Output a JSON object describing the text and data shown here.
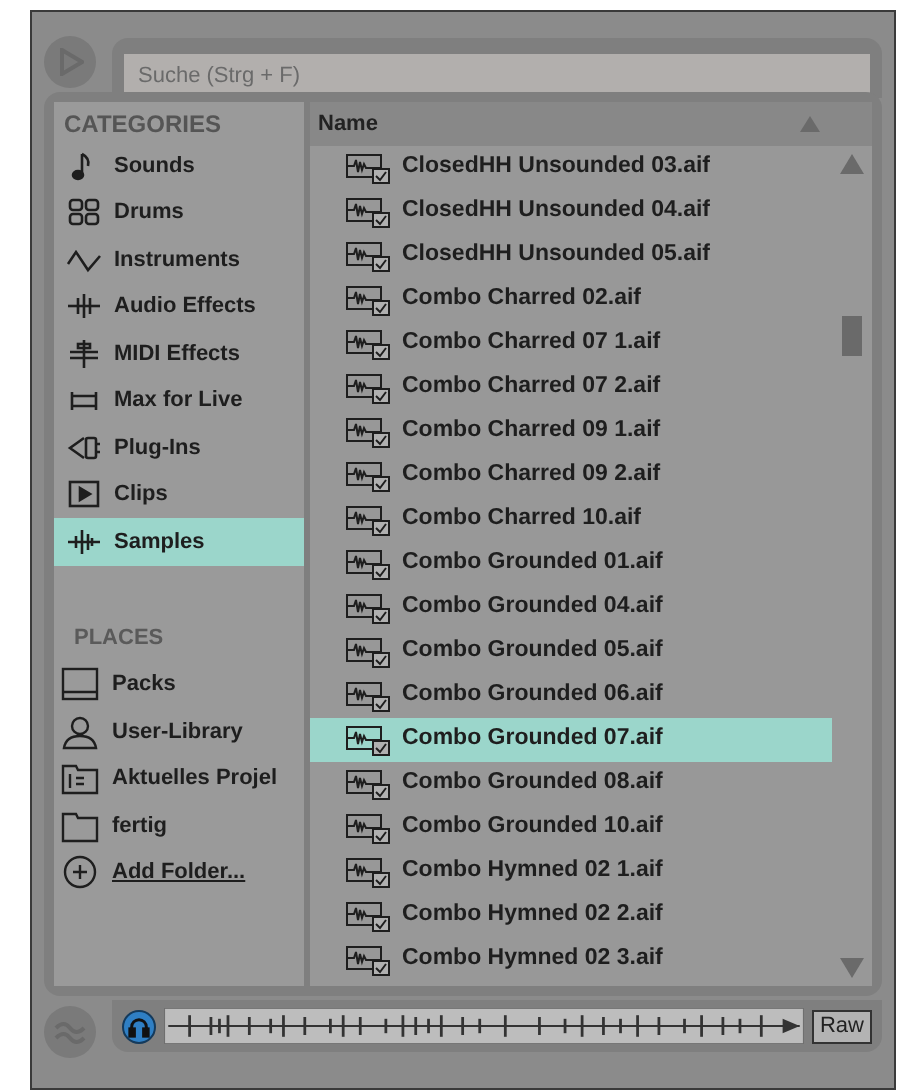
{
  "search": {
    "placeholder": "Suche (Strg + F)"
  },
  "categories": {
    "heading": "CATEGORIES",
    "items": [
      {
        "label": "Sounds",
        "selected": false
      },
      {
        "label": "Drums",
        "selected": false
      },
      {
        "label": "Instruments",
        "selected": false
      },
      {
        "label": "Audio Effects",
        "selected": false
      },
      {
        "label": "MIDI Effects",
        "selected": false
      },
      {
        "label": "Max for Live",
        "selected": false
      },
      {
        "label": "Plug-Ins",
        "selected": false
      },
      {
        "label": "Clips",
        "selected": false
      },
      {
        "label": "Samples",
        "selected": true
      }
    ]
  },
  "places": {
    "heading": "PLACES",
    "items": [
      {
        "label": "Packs",
        "kind": "place"
      },
      {
        "label": "User-Library",
        "kind": "place"
      },
      {
        "label": "Aktuelles Projel",
        "kind": "place"
      },
      {
        "label": "fertig",
        "kind": "place"
      },
      {
        "label": "Add Folder...",
        "kind": "action"
      }
    ]
  },
  "file_list": {
    "column": "Name",
    "rows": [
      {
        "name": "ClosedHH Unsounded 03.aif",
        "selected": false
      },
      {
        "name": "ClosedHH Unsounded 04.aif",
        "selected": false
      },
      {
        "name": "ClosedHH Unsounded 05.aif",
        "selected": false
      },
      {
        "name": "Combo Charred 02.aif",
        "selected": false
      },
      {
        "name": "Combo Charred 07 1.aif",
        "selected": false
      },
      {
        "name": "Combo Charred 07 2.aif",
        "selected": false
      },
      {
        "name": "Combo Charred 09 1.aif",
        "selected": false
      },
      {
        "name": "Combo Charred 09 2.aif",
        "selected": false
      },
      {
        "name": "Combo Charred 10.aif",
        "selected": false
      },
      {
        "name": "Combo Grounded 01.aif",
        "selected": false
      },
      {
        "name": "Combo Grounded 04.aif",
        "selected": false
      },
      {
        "name": "Combo Grounded 05.aif",
        "selected": false
      },
      {
        "name": "Combo Grounded 06.aif",
        "selected": false
      },
      {
        "name": "Combo Grounded 07.aif",
        "selected": true
      },
      {
        "name": "Combo Grounded 08.aif",
        "selected": false
      },
      {
        "name": "Combo Grounded 10.aif",
        "selected": false
      },
      {
        "name": "Combo Hymned 02 1.aif",
        "selected": false
      },
      {
        "name": "Combo Hymned 02 2.aif",
        "selected": false
      },
      {
        "name": "Combo Hymned 02 3.aif",
        "selected": false
      }
    ]
  },
  "preview": {
    "raw_button": "Raw",
    "preview_on": true
  }
}
